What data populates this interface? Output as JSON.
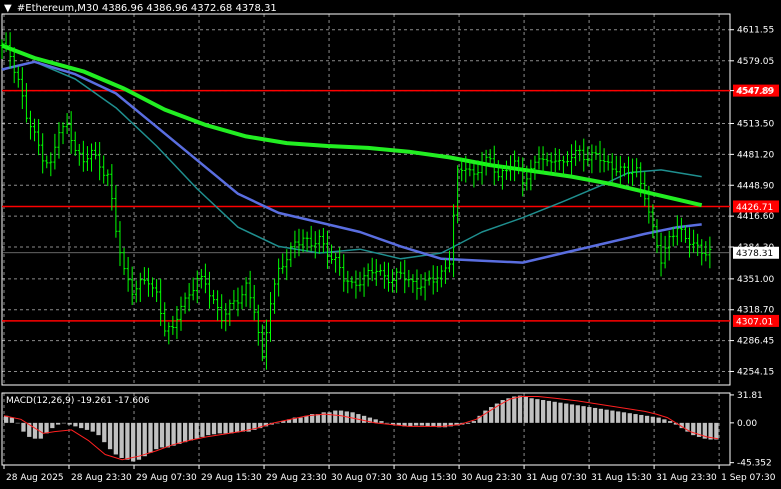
{
  "header": {
    "menu_glyph": "▼",
    "symbol": "#Ethereum,M30",
    "ohlc": "4386.96 4386.96 4372.68 4378.31"
  },
  "colors": {
    "background": "#000000",
    "candles": "#00ff00",
    "ma_fast": "#5a6ee0",
    "ma_mid": "#1f8f8f",
    "ma_slow": "#22ee22",
    "levels": "#ff0000",
    "macd_hist": "#c0c0c0",
    "macd_signal": "#ff2020",
    "grid": "#ffffff"
  },
  "chart_data": {
    "type": "line",
    "instrument": "#Ethereum,M30",
    "ylim": [
      4240,
      4628
    ],
    "yticks": [
      "4611.55",
      "4579.05",
      "4547.89",
      "4513.50",
      "4481.20",
      "4448.90",
      "4416.60",
      "4384.30",
      "4351.00",
      "4318.70",
      "4286.45",
      "4254.15"
    ],
    "x_tick_labels": [
      "28 Aug 2025",
      "28 Aug 23:30",
      "29 Aug 07:30",
      "29 Aug 15:30",
      "29 Aug 23:30",
      "30 Aug 07:30",
      "30 Aug 15:30",
      "30 Aug 23:30",
      "31 Aug 07:30",
      "31 Aug 15:30",
      "31 Aug 23:30",
      "1 Sep 07:30"
    ],
    "current_price": "4378.31",
    "levels": [
      {
        "value": 4547.89,
        "label": "4547.89"
      },
      {
        "value": 4426.71,
        "label": "4426.71"
      },
      {
        "value": 4307.01,
        "label": "4307.01"
      }
    ],
    "price_path": [
      [
        0,
        4595
      ],
      [
        2,
        4585
      ],
      [
        4,
        4560
      ],
      [
        6,
        4520
      ],
      [
        8,
        4500
      ],
      [
        10,
        4480
      ],
      [
        12,
        4470
      ],
      [
        14,
        4505
      ],
      [
        16,
        4510
      ],
      [
        18,
        4490
      ],
      [
        20,
        4470
      ],
      [
        22,
        4485
      ],
      [
        24,
        4470
      ],
      [
        26,
        4460
      ],
      [
        28,
        4400
      ],
      [
        30,
        4360
      ],
      [
        32,
        4340
      ],
      [
        34,
        4345
      ],
      [
        36,
        4348
      ],
      [
        38,
        4336
      ],
      [
        40,
        4300
      ],
      [
        42,
        4295
      ],
      [
        44,
        4325
      ],
      [
        46,
        4335
      ],
      [
        48,
        4350
      ],
      [
        50,
        4345
      ],
      [
        52,
        4330
      ],
      [
        54,
        4310
      ],
      [
        56,
        4320
      ],
      [
        58,
        4330
      ],
      [
        60,
        4345
      ],
      [
        62,
        4318
      ],
      [
        64,
        4265
      ],
      [
        66,
        4330
      ],
      [
        68,
        4360
      ],
      [
        70,
        4370
      ],
      [
        72,
        4390
      ],
      [
        74,
        4395
      ],
      [
        76,
        4385
      ],
      [
        78,
        4392
      ],
      [
        80,
        4380
      ],
      [
        82,
        4370
      ],
      [
        84,
        4350
      ],
      [
        86,
        4345
      ],
      [
        88,
        4350
      ],
      [
        90,
        4355
      ],
      [
        92,
        4360
      ],
      [
        94,
        4355
      ],
      [
        96,
        4350
      ],
      [
        98,
        4355
      ],
      [
        100,
        4350
      ],
      [
        102,
        4345
      ],
      [
        104,
        4345
      ],
      [
        106,
        4350
      ],
      [
        108,
        4358
      ],
      [
        110,
        4370
      ],
      [
        112,
        4460
      ],
      [
        114,
        4470
      ],
      [
        116,
        4460
      ],
      [
        118,
        4470
      ],
      [
        120,
        4475
      ],
      [
        122,
        4460
      ],
      [
        124,
        4465
      ],
      [
        126,
        4470
      ],
      [
        128,
        4455
      ],
      [
        130,
        4465
      ],
      [
        132,
        4478
      ],
      [
        134,
        4470
      ],
      [
        136,
        4480
      ],
      [
        138,
        4470
      ],
      [
        140,
        4478
      ],
      [
        142,
        4485
      ],
      [
        144,
        4478
      ],
      [
        146,
        4480
      ],
      [
        148,
        4472
      ],
      [
        150,
        4470
      ],
      [
        152,
        4465
      ],
      [
        154,
        4462
      ],
      [
        156,
        4465
      ],
      [
        158,
        4440
      ],
      [
        160,
        4400
      ],
      [
        162,
        4370
      ],
      [
        164,
        4395
      ],
      [
        166,
        4405
      ],
      [
        168,
        4390
      ],
      [
        170,
        4390
      ],
      [
        172,
        4380
      ],
      [
        174,
        4378
      ]
    ],
    "series": [
      {
        "points": [
          [
            0,
            4595
          ],
          [
            8,
            4582
          ],
          [
            20,
            4568
          ],
          [
            30,
            4550
          ],
          [
            40,
            4528
          ],
          [
            50,
            4512
          ],
          [
            60,
            4500
          ],
          [
            70,
            4493
          ],
          [
            80,
            4490
          ],
          [
            90,
            4488
          ],
          [
            100,
            4484
          ],
          [
            110,
            4478
          ],
          [
            120,
            4470
          ],
          [
            130,
            4464
          ],
          [
            140,
            4458
          ],
          [
            150,
            4450
          ],
          [
            160,
            4440
          ],
          [
            172,
            4428
          ]
        ]
      },
      {
        "points": [
          [
            0,
            4570
          ],
          [
            8,
            4578
          ],
          [
            18,
            4560
          ],
          [
            28,
            4530
          ],
          [
            38,
            4490
          ],
          [
            48,
            4445
          ],
          [
            58,
            4405
          ],
          [
            68,
            4385
          ],
          [
            78,
            4378
          ],
          [
            88,
            4382
          ],
          [
            98,
            4372
          ],
          [
            108,
            4378
          ],
          [
            118,
            4400
          ],
          [
            128,
            4415
          ],
          [
            138,
            4432
          ],
          [
            148,
            4450
          ],
          [
            154,
            4462
          ],
          [
            162,
            4465
          ],
          [
            172,
            4458
          ]
        ]
      },
      {
        "points": [
          [
            0,
            4570
          ],
          [
            8,
            4578
          ],
          [
            18,
            4565
          ],
          [
            28,
            4545
          ],
          [
            38,
            4510
          ],
          [
            48,
            4475
          ],
          [
            58,
            4440
          ],
          [
            68,
            4420
          ],
          [
            78,
            4410
          ],
          [
            88,
            4400
          ],
          [
            98,
            4385
          ],
          [
            108,
            4372
          ],
          [
            118,
            4370
          ],
          [
            128,
            4368
          ],
          [
            138,
            4378
          ],
          [
            148,
            4388
          ],
          [
            158,
            4398
          ],
          [
            166,
            4405
          ],
          [
            172,
            4408
          ]
        ]
      }
    ],
    "macd": {
      "label": "MACD(12,26,9) -19.261 -17.606",
      "ylim": [
        -48,
        34
      ],
      "yticks": [
        "31.81",
        "0.00",
        "-45.352"
      ],
      "histogram": [
        8,
        6,
        0,
        -10,
        -16,
        -18,
        -18,
        -12,
        -6,
        -2,
        0,
        -2,
        -4,
        -6,
        -8,
        -10,
        -14,
        -22,
        -30,
        -36,
        -40,
        -42,
        -44,
        -42,
        -38,
        -34,
        -30,
        -28,
        -28,
        -26,
        -24,
        -22,
        -20,
        -18,
        -16,
        -14,
        -13,
        -12,
        -12,
        -12,
        -11,
        -10,
        -10,
        -8,
        -6,
        -4,
        -2,
        0,
        2,
        4,
        6,
        6,
        8,
        10,
        10,
        12,
        12,
        14,
        14,
        13,
        12,
        10,
        8,
        6,
        4,
        2,
        0,
        -2,
        -3,
        -4,
        -4,
        -3,
        -3,
        -4,
        -4,
        -5,
        -5,
        -4,
        -3,
        -2,
        -1,
        2,
        8,
        14,
        18,
        22,
        26,
        28,
        30,
        31,
        30,
        28,
        27,
        26,
        25,
        24,
        23,
        22,
        21,
        20,
        19,
        18,
        17,
        16,
        15,
        14,
        13,
        12,
        11,
        10,
        9,
        8,
        7,
        6,
        4,
        2,
        -2,
        -6,
        -10,
        -14,
        -16,
        -18,
        -19,
        -19
      ],
      "signal": [
        [
          0,
          8
        ],
        [
          6,
          4
        ],
        [
          10,
          -4
        ],
        [
          14,
          -12
        ],
        [
          18,
          -10
        ],
        [
          24,
          -8
        ],
        [
          30,
          -20
        ],
        [
          36,
          -36
        ],
        [
          42,
          -42
        ],
        [
          48,
          -38
        ],
        [
          54,
          -32
        ],
        [
          60,
          -25
        ],
        [
          66,
          -20
        ],
        [
          72,
          -16
        ],
        [
          78,
          -13
        ],
        [
          84,
          -10
        ],
        [
          90,
          -6
        ],
        [
          96,
          0
        ],
        [
          102,
          4
        ],
        [
          108,
          8
        ],
        [
          114,
          10
        ],
        [
          120,
          8
        ],
        [
          126,
          4
        ],
        [
          132,
          0
        ],
        [
          138,
          -2
        ],
        [
          144,
          -4
        ],
        [
          150,
          -4
        ],
        [
          156,
          -4
        ],
        [
          162,
          -2
        ],
        [
          168,
          4
        ],
        [
          172,
          12
        ],
        [
          176,
          20
        ],
        [
          180,
          27
        ],
        [
          184,
          30
        ],
        [
          190,
          30
        ],
        [
          196,
          28
        ],
        [
          204,
          25
        ],
        [
          212,
          21
        ],
        [
          220,
          17
        ],
        [
          228,
          13
        ],
        [
          232,
          10
        ],
        [
          236,
          6
        ],
        [
          240,
          -2
        ],
        [
          244,
          -10
        ],
        [
          250,
          -16
        ],
        [
          254,
          -18
        ]
      ]
    }
  }
}
